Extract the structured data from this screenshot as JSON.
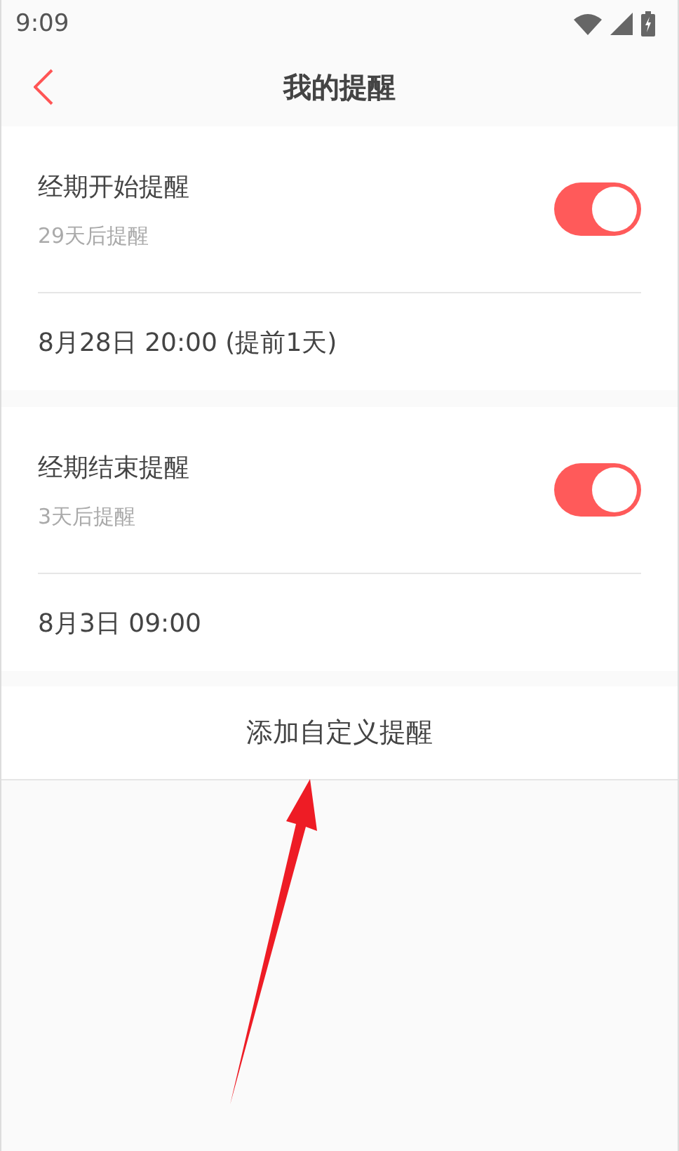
{
  "status_bar": {
    "time": "9:09"
  },
  "header": {
    "title": "我的提醒"
  },
  "reminders": [
    {
      "title": "经期开始提醒",
      "subtitle": "29天后提醒",
      "on": true,
      "time": "8月28日 20:00 (提前1天)"
    },
    {
      "title": "经期结束提醒",
      "subtitle": "3天后提醒",
      "on": true,
      "time": "8月3日 09:00"
    }
  ],
  "add_button": {
    "label": "添加自定义提醒"
  }
}
